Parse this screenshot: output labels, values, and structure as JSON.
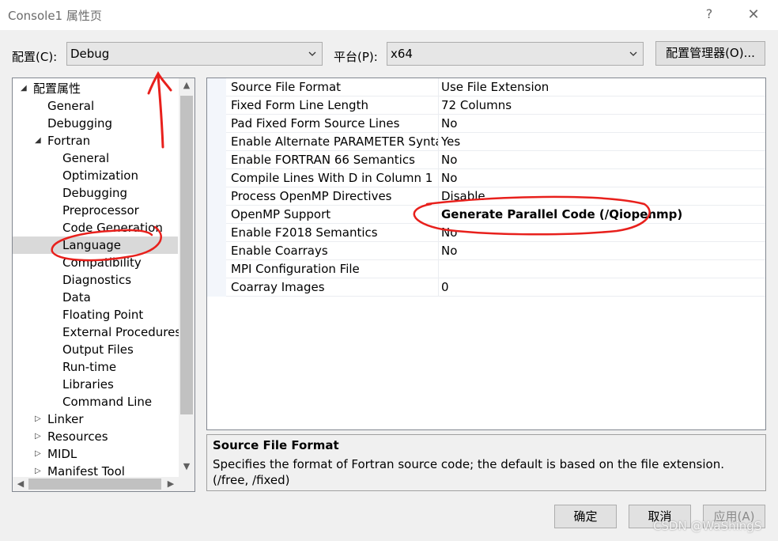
{
  "window": {
    "title": "Console1 属性页",
    "help": "?",
    "close": "✕"
  },
  "config": {
    "label": "配置(C):",
    "value": "Debug",
    "platform_label": "平台(P):",
    "platform_value": "x64",
    "manager_button": "配置管理器(O)..."
  },
  "tree": [
    {
      "label": "配置属性",
      "level": 0,
      "expander": "expanded"
    },
    {
      "label": "General",
      "level": 1
    },
    {
      "label": "Debugging",
      "level": 1
    },
    {
      "label": "Fortran",
      "level": 1,
      "expander": "expanded"
    },
    {
      "label": "General",
      "level": 2
    },
    {
      "label": "Optimization",
      "level": 2
    },
    {
      "label": "Debugging",
      "level": 2
    },
    {
      "label": "Preprocessor",
      "level": 2
    },
    {
      "label": "Code Generation",
      "level": 2
    },
    {
      "label": "Language",
      "level": 2,
      "selected": true
    },
    {
      "label": "Compatibility",
      "level": 2
    },
    {
      "label": "Diagnostics",
      "level": 2
    },
    {
      "label": "Data",
      "level": 2
    },
    {
      "label": "Floating Point",
      "level": 2
    },
    {
      "label": "External Procedures",
      "level": 2
    },
    {
      "label": "Output Files",
      "level": 2
    },
    {
      "label": "Run-time",
      "level": 2
    },
    {
      "label": "Libraries",
      "level": 2
    },
    {
      "label": "Command Line",
      "level": 2
    },
    {
      "label": "Linker",
      "level": 1,
      "expander": "collapsed"
    },
    {
      "label": "Resources",
      "level": 1,
      "expander": "collapsed"
    },
    {
      "label": "MIDL",
      "level": 1,
      "expander": "collapsed"
    },
    {
      "label": "Manifest Tool",
      "level": 1,
      "expander": "collapsed"
    }
  ],
  "properties": [
    {
      "name": "Source File Format",
      "value": "Use File Extension"
    },
    {
      "name": "Fixed Form Line Length",
      "value": "72 Columns"
    },
    {
      "name": "Pad Fixed Form Source Lines",
      "value": "No"
    },
    {
      "name": "Enable Alternate PARAMETER Syntax",
      "value": "Yes"
    },
    {
      "name": "Enable FORTRAN 66 Semantics",
      "value": "No"
    },
    {
      "name": "Compile Lines With D in Column 1",
      "value": "No"
    },
    {
      "name": "Process OpenMP Directives",
      "value": "Disable"
    },
    {
      "name": "OpenMP Support",
      "value": "Generate Parallel Code (/Qiopenmp)",
      "bold": true
    },
    {
      "name": "Enable F2018 Semantics",
      "value": "No"
    },
    {
      "name": "Enable Coarrays",
      "value": "No"
    },
    {
      "name": "MPI Configuration File",
      "value": ""
    },
    {
      "name": "Coarray Images",
      "value": "0"
    }
  ],
  "description": {
    "title": "Source File Format",
    "text": "Specifies the format of Fortran source code; the default is based on the file extension. (/free, /fixed)"
  },
  "buttons": {
    "ok": "确定",
    "cancel": "取消",
    "apply": "应用(A)"
  },
  "watermark": "CSDN @WaShingS",
  "colors": {
    "annotation": "#e8201c",
    "selection": "#d9d9d9"
  }
}
